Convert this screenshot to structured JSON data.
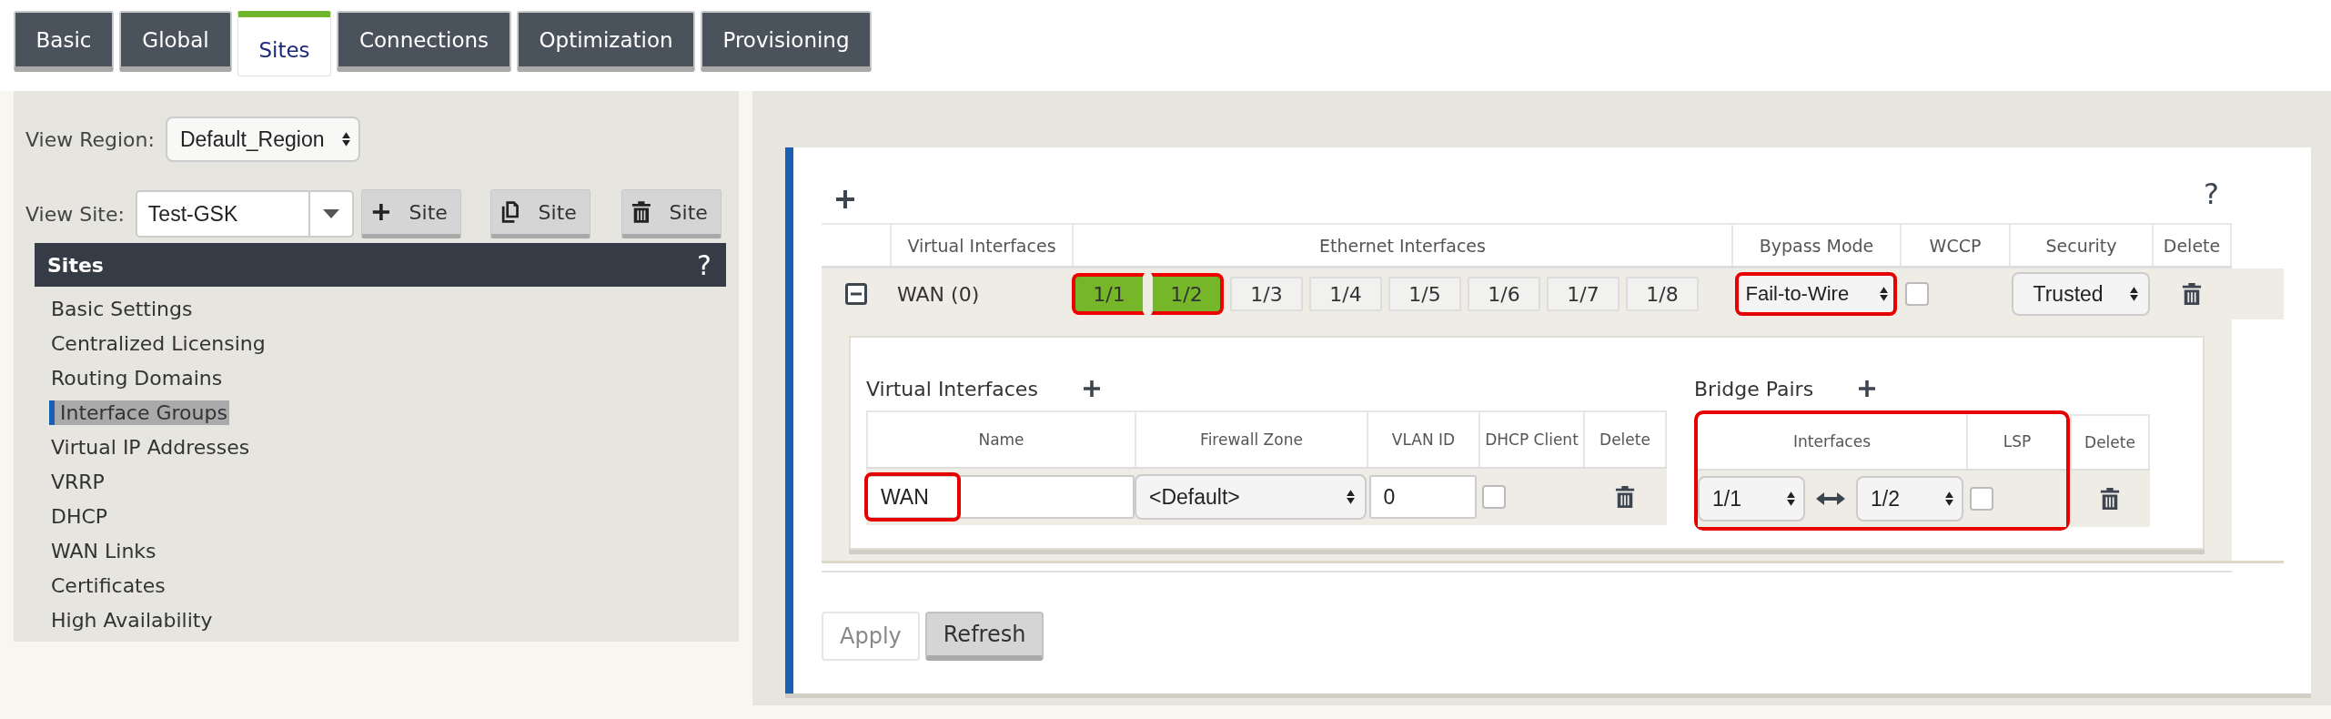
{
  "tabs": [
    {
      "label": "Basic",
      "selected": false
    },
    {
      "label": "Global",
      "selected": false
    },
    {
      "label": "Sites",
      "selected": true
    },
    {
      "label": "Connections",
      "selected": false
    },
    {
      "label": "Optimization",
      "selected": false
    },
    {
      "label": "Provisioning",
      "selected": false
    }
  ],
  "view_region": {
    "label": "View Region:",
    "value": "Default_Region"
  },
  "view_site": {
    "label": "View Site:",
    "value": "Test-GSK"
  },
  "site_buttons": [
    {
      "kind": "add",
      "label": "Site"
    },
    {
      "kind": "copy",
      "label": "Site"
    },
    {
      "kind": "delete",
      "label": "Site"
    }
  ],
  "sidebar": {
    "title": "Sites",
    "help": "?",
    "items": [
      {
        "label": "Basic Settings",
        "selected": false
      },
      {
        "label": "Centralized Licensing",
        "selected": false
      },
      {
        "label": "Routing Domains",
        "selected": false
      },
      {
        "label": "Interface Groups",
        "selected": true
      },
      {
        "label": "Virtual IP Addresses",
        "selected": false
      },
      {
        "label": "VRRP",
        "selected": false
      },
      {
        "label": "DHCP",
        "selected": false
      },
      {
        "label": "WAN Links",
        "selected": false
      },
      {
        "label": "Certificates",
        "selected": false
      },
      {
        "label": "High Availability",
        "selected": false
      }
    ]
  },
  "interface_groups": {
    "help": "?",
    "columns": [
      "Virtual Interfaces",
      "Ethernet Interfaces",
      "Bypass Mode",
      "WCCP",
      "Security",
      "Delete"
    ],
    "rows": [
      {
        "expanded": true,
        "virtual_interfaces": "WAN (0)",
        "ethernet": [
          {
            "label": "1/1",
            "selected": true,
            "highlighted": true
          },
          {
            "label": "1/2",
            "selected": true,
            "highlighted": true
          },
          {
            "label": "1/3",
            "selected": false,
            "highlighted": false
          },
          {
            "label": "1/4",
            "selected": false,
            "highlighted": false
          },
          {
            "label": "1/5",
            "selected": false,
            "highlighted": false
          },
          {
            "label": "1/6",
            "selected": false,
            "highlighted": false
          },
          {
            "label": "1/7",
            "selected": false,
            "highlighted": false
          },
          {
            "label": "1/8",
            "selected": false,
            "highlighted": false
          }
        ],
        "bypass_mode": {
          "value": "Fail-to-Wire",
          "highlighted": true
        },
        "wccp": {
          "checked": false
        },
        "security": "Trusted",
        "virtual_interfaces_table": {
          "title": "Virtual Interfaces",
          "columns": [
            "Name",
            "Firewall Zone",
            "VLAN ID",
            "DHCP Client",
            "Delete"
          ],
          "rows": [
            {
              "name": "WAN",
              "name_highlighted": true,
              "firewall_zone": "<Default>",
              "vlan_id": "0",
              "dhcp_client": false
            }
          ]
        },
        "bridge_pairs": {
          "title": "Bridge Pairs",
          "highlighted": true,
          "columns": [
            "Interfaces",
            "LSP",
            "Delete"
          ],
          "rows": [
            {
              "interface_a": "1/1",
              "interface_b": "1/2",
              "lsp": false
            }
          ]
        }
      }
    ]
  },
  "buttons": [
    {
      "label": "Apply",
      "disabled": true
    },
    {
      "label": "Refresh",
      "disabled": false
    }
  ]
}
